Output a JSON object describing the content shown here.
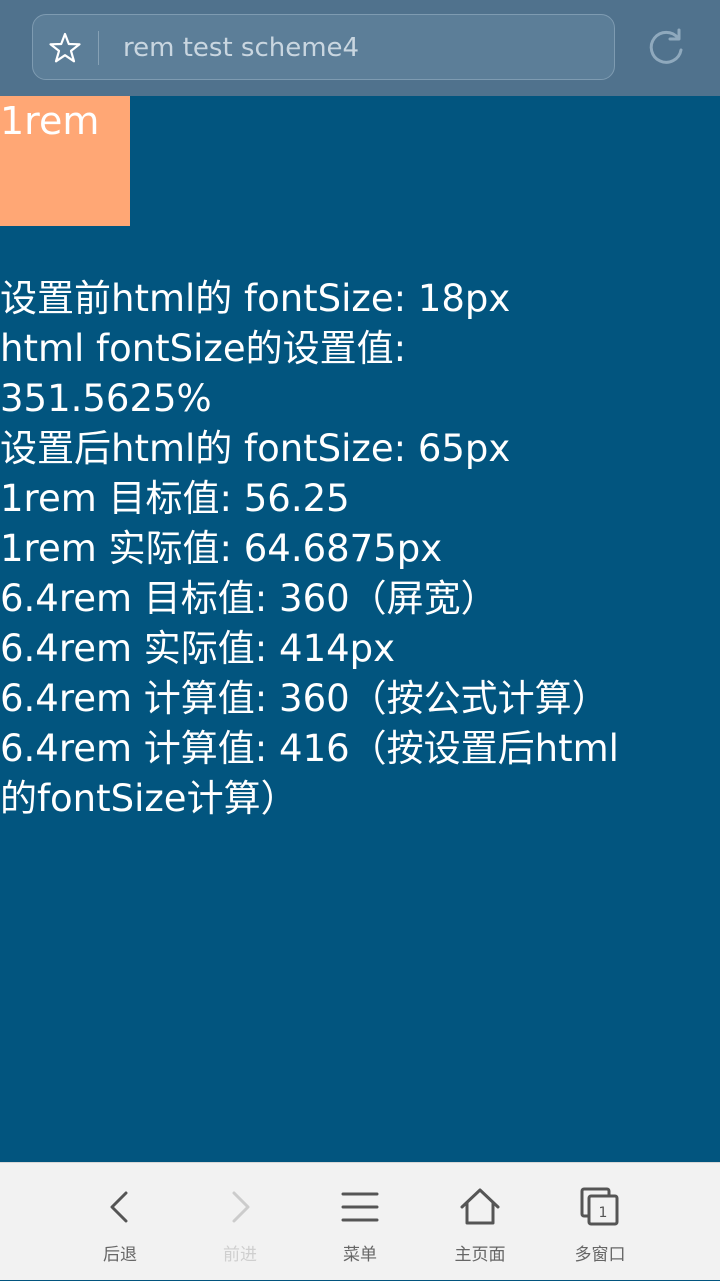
{
  "address_bar": {
    "url_text": "rem test scheme4",
    "icons": [
      "star-icon",
      "reload-icon"
    ]
  },
  "content": {
    "rem_box_label": "1rem",
    "lines": [
      "设置前html的 fontSize: 18px",
      "html fontSize的设置值: 351.5625%",
      "设置后html的 fontSize: 65px",
      "1rem 目标值: 56.25",
      "1rem 实际值: 64.6875px",
      "6.4rem 目标值: 360（屏宽）",
      "6.4rem 实际值: 414px",
      "6.4rem 计算值: 360（按公式计算）",
      "6.4rem 计算值: 416（按设置后html的fontSize计算）"
    ]
  },
  "toolbar": {
    "back_label": "后退",
    "forward_label": "前进",
    "menu_label": "菜单",
    "home_label": "主页面",
    "windows_label": "多窗口",
    "windows_count": "1"
  },
  "colors": {
    "page_background": "#02557f",
    "address_bar_background": "#50728d",
    "rem_box": "#ffa775",
    "toolbar_background": "#f2f2f2"
  }
}
